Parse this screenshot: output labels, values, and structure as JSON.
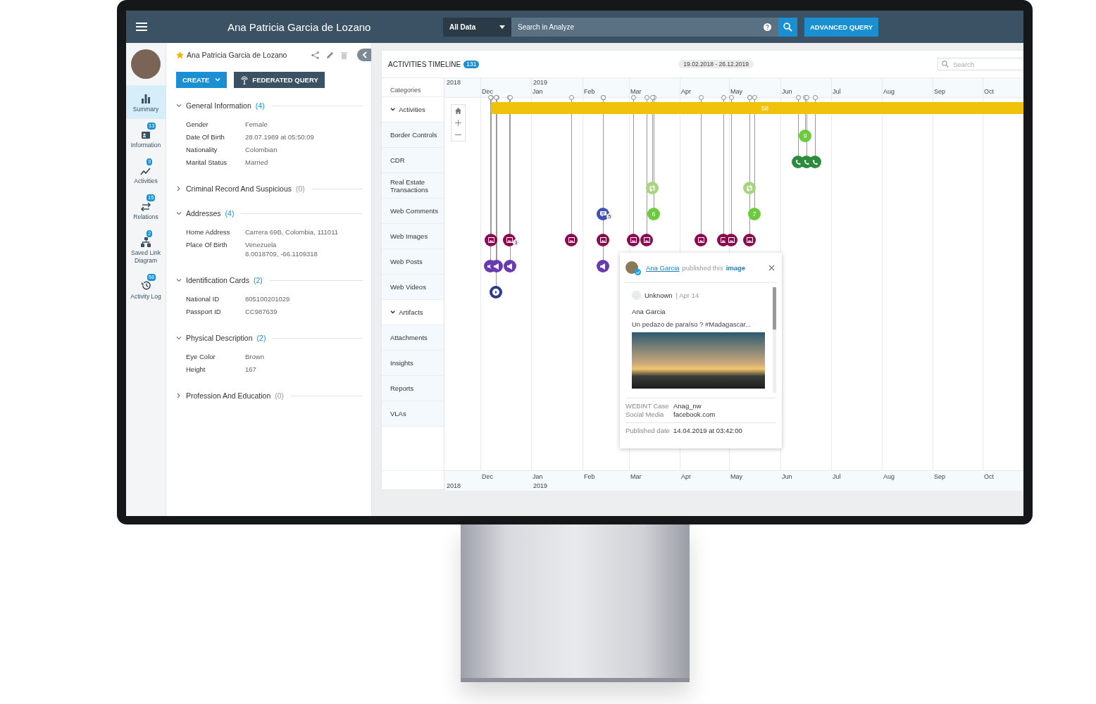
{
  "header": {
    "title": "Ana Patricia Garcia de Lozano",
    "scope": "All Data",
    "search": {
      "placeholder": "Search in Analyze"
    },
    "advanced_button": "ADVANCED QUERY"
  },
  "nav": [
    {
      "label": "Summary",
      "selected": true
    },
    {
      "label": "Information",
      "badge": "13",
      "selected": false
    },
    {
      "label": "Activities",
      "badge": "3",
      "selected": false
    },
    {
      "label": "Relations",
      "badge": "15",
      "selected": false
    },
    {
      "label": "Saved Link Diagram",
      "badge": "2",
      "selected": false
    },
    {
      "label": "Activity Log",
      "badge": "58",
      "selected": false
    }
  ],
  "profile": {
    "name": "Ana Patricia Garcia de Lozano",
    "starred": true,
    "create_button": "CREATE",
    "federated_button": "FEDERATED QUERY",
    "sections": [
      {
        "title": "General Information",
        "count": "(4)",
        "expanded": true,
        "fields": [
          {
            "label": "Gender",
            "value": "Female"
          },
          {
            "label": "Date Of Birth",
            "value": "28.07.1989 at 05:50:09"
          },
          {
            "label": "Nationality",
            "value": "Colombian"
          },
          {
            "label": "Marital Status",
            "value": "Married"
          }
        ]
      },
      {
        "title": "Criminal Record And Suspicious",
        "count": "(0)",
        "expanded": false
      },
      {
        "title": "Addresses",
        "count": "(4)",
        "expanded": true,
        "fields": [
          {
            "label": "Home Address",
            "value": "Carrera 69B, Colombia, 111011"
          },
          {
            "label": "Place Of Birth",
            "value": "Venezuela\n8.0018709, -66.1109318"
          }
        ]
      },
      {
        "title": "Identification Cards",
        "count": "(2)",
        "expanded": true,
        "fields": [
          {
            "label": "National ID",
            "value": "805100201029"
          },
          {
            "label": "Passport ID",
            "value": "CC987639"
          }
        ]
      },
      {
        "title": "Physical Description",
        "count": "(2)",
        "expanded": true,
        "fields": [
          {
            "label": "Eye Color",
            "value": "Brown"
          },
          {
            "label": "Height",
            "value": "167"
          }
        ]
      },
      {
        "title": "Profession And Education",
        "count": "(0)",
        "expanded": false
      }
    ]
  },
  "timeline": {
    "title": "ACTIVITIES TIMELINE",
    "count": "131",
    "range": "19.02.2018 - 26.12.2019",
    "search": {
      "placeholder": "Search"
    },
    "categories_label": "Categories",
    "rows": [
      {
        "label": "Activities",
        "kind": "group",
        "expanded": true
      },
      {
        "label": "Border Controls",
        "kind": "category"
      },
      {
        "label": "CDR",
        "kind": "category"
      },
      {
        "label": "Real Estate Transactions",
        "kind": "category"
      },
      {
        "label": "Web Comments",
        "kind": "category"
      },
      {
        "label": "Web Images",
        "kind": "category"
      },
      {
        "label": "Web Posts",
        "kind": "category"
      },
      {
        "label": "Web Videos",
        "kind": "category"
      },
      {
        "label": "Artifacts",
        "kind": "group",
        "expanded": true
      },
      {
        "label": "Attachments",
        "kind": "category"
      },
      {
        "label": "Insights",
        "kind": "category"
      },
      {
        "label": "Reports",
        "kind": "category"
      },
      {
        "label": "VLAs",
        "kind": "category"
      }
    ],
    "years": [
      "2018",
      "2019"
    ],
    "months": [
      "Dec",
      "Jan",
      "Feb",
      "Mar",
      "Apr",
      "May",
      "Jun",
      "Jul",
      "Aug",
      "Sep",
      "Oct"
    ],
    "bottom_months": [
      "Dec",
      "Jan",
      "Feb",
      "Mar",
      "Apr",
      "May",
      "Jun",
      "Jul",
      "Aug",
      "Sep",
      "Oct"
    ],
    "bottom_years": [
      "2018",
      "2019"
    ],
    "bar": {
      "count": "58"
    },
    "markers": [
      {
        "kind": "image"
      },
      {
        "kind": "image",
        "count": "3"
      },
      {
        "kind": "image"
      },
      {
        "kind": "image"
      },
      {
        "kind": "image"
      },
      {
        "kind": "image"
      },
      {
        "kind": "image"
      },
      {
        "kind": "image"
      },
      {
        "kind": "image"
      },
      {
        "kind": "image"
      },
      {
        "kind": "post"
      },
      {
        "kind": "post"
      },
      {
        "kind": "post"
      },
      {
        "kind": "post"
      },
      {
        "kind": "video"
      },
      {
        "kind": "comment",
        "count": "5"
      },
      {
        "kind": "cluster",
        "count": "6"
      },
      {
        "kind": "cluster",
        "count": "7"
      },
      {
        "kind": "repost"
      },
      {
        "kind": "repost"
      },
      {
        "kind": "cluster",
        "count": "9"
      },
      {
        "kind": "call"
      },
      {
        "kind": "call"
      },
      {
        "kind": "call"
      }
    ],
    "popup": {
      "author": "Ana Garcia",
      "action": "published this",
      "object": "image",
      "source": "Unknown",
      "date": "| Apr 14",
      "poster": "Ana Garcia",
      "text": "Un pedazo de paraíso ? #Madagascar...",
      "details": [
        {
          "label": "WEBINT Case",
          "value": "Anag_nw"
        },
        {
          "label": "Social Media",
          "value": "facebook.com"
        },
        {
          "label": "Published date",
          "value": "14.04.2019 at 03:42:00"
        }
      ]
    }
  }
}
